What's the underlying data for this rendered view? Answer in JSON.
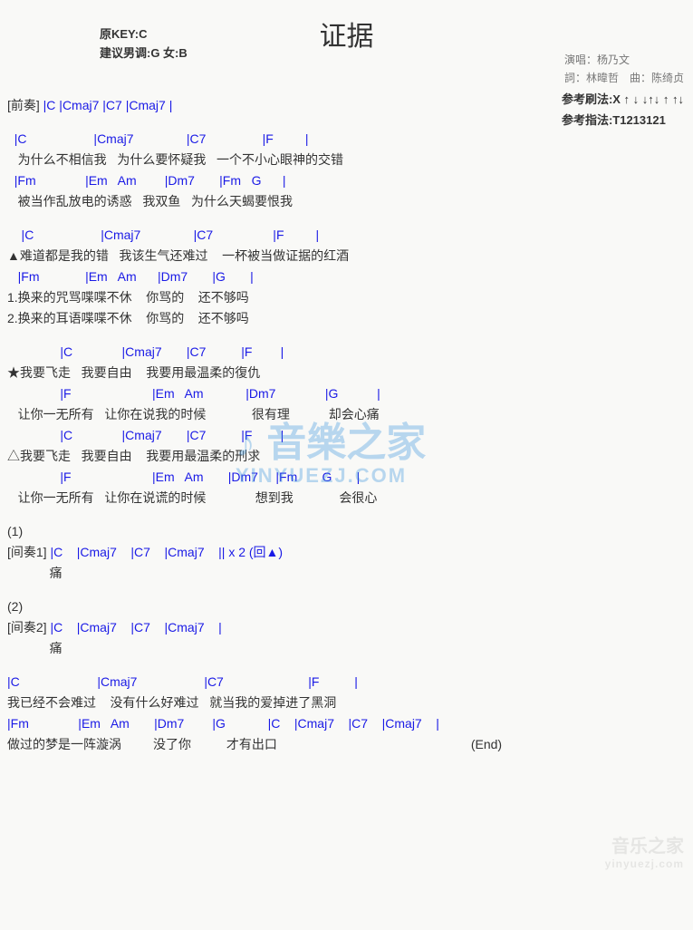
{
  "title": "证据",
  "header_left": {
    "line1": "原KEY:C",
    "line2": "建议男调:G 女:B"
  },
  "header_right": {
    "line1": "演唱：杨乃文",
    "line2": "詞：林暐哲　曲：陈绮贞"
  },
  "header_right2": {
    "line1": "参考刷法:X ↑ ↓ ↓↑↓ ↑ ↑↓",
    "line2": "参考指法:T1213121"
  },
  "intro": {
    "label": "[前奏]",
    "chords": " |C    |Cmaj7   |C7    |Cmaj7   |"
  },
  "verse1": {
    "chord1": "  |C                   |Cmaj7               |C7                |F         |",
    "lyric1": "   为什么不相信我   为什么要怀疑我   一个不小心眼神的交错",
    "chord2": "  |Fm              |Em   Am        |Dm7       |Fm   G      |",
    "lyric2": "   被当作乱放电的诱惑   我双鱼   为什么天蝎要恨我"
  },
  "verse2": {
    "chord1": "    |C                   |Cmaj7               |C7                 |F         |",
    "lyric1": "▲难道都是我的错   我该生气还难过    一杯被当做证据的红酒",
    "chord2": "   |Fm             |Em   Am      |Dm7       |G       |",
    "lyric2a": "1.换来的咒骂喋喋不休    你骂的    还不够吗",
    "lyric2b": "2.换来的耳语喋喋不休    你骂的    还不够吗"
  },
  "chorus1": {
    "chord1": "               |C              |Cmaj7       |C7          |F        |",
    "lyric1": "★我要飞走   我要自由    我要用最温柔的復仇",
    "chord2": "               |F                       |Em   Am            |Dm7              |G           |",
    "lyric2": "   让你一无所有   让你在说我的时候             很有理           却会心痛",
    "chord3": "               |C              |Cmaj7       |C7          |F        |",
    "lyric3": "△我要飞走   我要自由    我要用最温柔的刑求",
    "chord4": "               |F                       |Em   Am       |Dm7     |Fm       G       |",
    "lyric4": "   让你一无所有   让你在说谎的时候              想到我             会很心"
  },
  "interlude1": {
    "label1": "(1)",
    "label2": "[间奏1]",
    "chords": " |C    |Cmaj7    |C7    |Cmaj7    || x 2 (回▲)",
    "tail": "            痛"
  },
  "interlude2": {
    "label1": "(2)",
    "label2": "[间奏2]",
    "chords": " |C    |Cmaj7    |C7    |Cmaj7    |",
    "tail": "            痛"
  },
  "outro": {
    "chord1": "|C                      |Cmaj7                   |C7                        |F          |",
    "lyric1": "我已经不会难过    没有什么好难过   就当我的爱掉进了黑洞",
    "chord2": "|Fm              |Em   Am       |Dm7        |G            |C    |Cmaj7    |C7    |Cmaj7    |",
    "lyric2": "做过的梦是一阵漩涡         没了你          才有出口                                                       (End)"
  },
  "watermark": {
    "main": "♪ 音樂之家",
    "sub": "YINYUEZJ.COM"
  },
  "footer_wm": {
    "main": "音乐之家",
    "sub": "yinyuezj.com"
  }
}
